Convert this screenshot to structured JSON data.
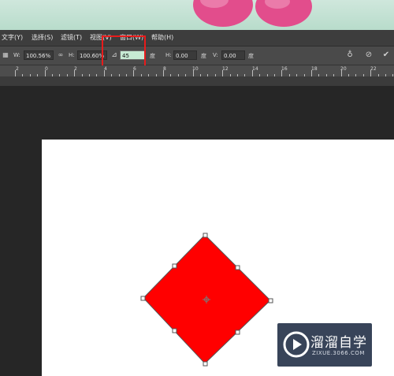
{
  "menu": {
    "items": [
      "文字(Y)",
      "选择(S)",
      "滤镜(T)",
      "视图(V)",
      "窗口(W)",
      "帮助(H)"
    ]
  },
  "options": {
    "ref_icon": "reference-point-icon",
    "w_label": "W:",
    "w_value": "100.56%",
    "link_icon": "link-icon",
    "h_label": "H:",
    "h_value": "100.60%",
    "angle_icon": "angle-icon",
    "angle_value": "45",
    "angle_unit": "度",
    "hskew_label": "H:",
    "hskew_value": "0.00",
    "hskew_unit": "度",
    "vskew_label": "V:",
    "vskew_value": "0.00",
    "vskew_unit": "度",
    "warp_icon": "warp-icon",
    "cancel_icon": "cancel-icon",
    "commit_icon": "commit-checkmark-icon"
  },
  "ruler": {
    "labels": [
      "2",
      "0",
      "2",
      "4",
      "6",
      "8",
      "10",
      "12",
      "14",
      "16",
      "18",
      "20",
      "22"
    ]
  },
  "shape": {
    "fill": "#ff0000",
    "stroke": "#555555",
    "rotation_deg": 45
  },
  "watermark": {
    "title": "溜溜自学",
    "url": "ZIXUE.3066.COM"
  },
  "colors": {
    "highlight": "#e81b1b",
    "angle_field_active": "#c7ead4"
  }
}
